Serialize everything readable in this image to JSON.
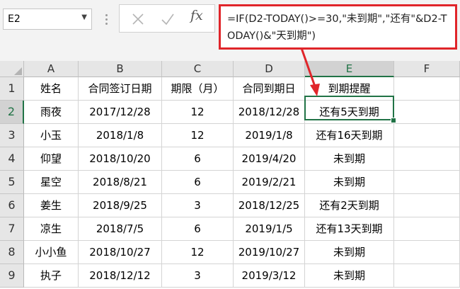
{
  "name_box": {
    "value": "E2",
    "dropdown_icon": "chevron-down-icon"
  },
  "formula_bar": {
    "cancel_icon": "close-icon",
    "enter_icon": "check-icon",
    "fx_label": "fx",
    "formula": "=IF(D2-TODAY()>=30,\"未到期\",\"还有\"&D2-TODAY()&\"天到期\")"
  },
  "columns": [
    "A",
    "B",
    "C",
    "D",
    "E",
    "F"
  ],
  "rows": [
    "1",
    "2",
    "3",
    "4",
    "5",
    "6",
    "7",
    "8",
    "9"
  ],
  "sheet": {
    "headers": [
      "姓名",
      "合同签订日期",
      "期限（月）",
      "合同到期日",
      "到期提醒",
      ""
    ],
    "data": [
      [
        "雨夜",
        "2017/12/28",
        "12",
        "2018/12/28",
        "还有5天到期",
        ""
      ],
      [
        "小玉",
        "2018/1/8",
        "12",
        "2019/1/8",
        "还有16天到期",
        ""
      ],
      [
        "仰望",
        "2018/10/20",
        "6",
        "2019/4/20",
        "未到期",
        ""
      ],
      [
        "星空",
        "2018/8/21",
        "6",
        "2019/2/21",
        "未到期",
        ""
      ],
      [
        "姜生",
        "2018/9/25",
        "3",
        "2018/12/25",
        "还有2天到期",
        ""
      ],
      [
        "凉生",
        "2018/7/5",
        "6",
        "2019/1/5",
        "还有13天到期",
        ""
      ],
      [
        "小小鱼",
        "2018/10/27",
        "12",
        "2019/10/27",
        "未到期",
        ""
      ],
      [
        "执子",
        "2018/12/12",
        "3",
        "2019/3/12",
        "未到期",
        ""
      ]
    ]
  },
  "selection": {
    "cell": "E2",
    "highlight_color": "#217346"
  },
  "annotation": {
    "border_color": "#e0252a"
  }
}
